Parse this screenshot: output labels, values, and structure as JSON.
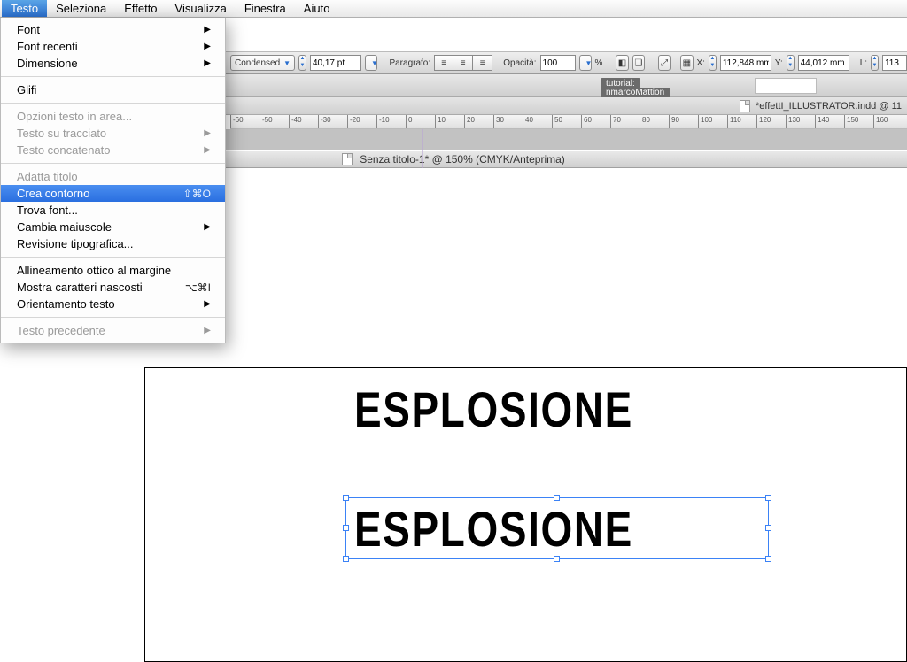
{
  "menubar": {
    "items": [
      "Testo",
      "Seleziona",
      "Effetto",
      "Visualizza",
      "Finestra",
      "Aiuto"
    ],
    "active_index": 0
  },
  "dropdown": {
    "groups": [
      [
        {
          "label": "Font",
          "submenu": true
        },
        {
          "label": "Font recenti",
          "submenu": true
        },
        {
          "label": "Dimensione",
          "submenu": true
        }
      ],
      [
        {
          "label": "Glifi"
        }
      ],
      [
        {
          "label": "Opzioni testo in area...",
          "disabled": true
        },
        {
          "label": "Testo su tracciato",
          "submenu": true,
          "disabled": true
        },
        {
          "label": "Testo concatenato",
          "submenu": true,
          "disabled": true
        }
      ],
      [
        {
          "label": "Adatta titolo",
          "disabled": true
        },
        {
          "label": "Crea contorno",
          "shortcut": "⇧⌘O",
          "highlight": true
        },
        {
          "label": "Trova font..."
        },
        {
          "label": "Cambia maiuscole",
          "submenu": true
        },
        {
          "label": "Revisione tipografica..."
        }
      ],
      [
        {
          "label": "Allineamento ottico al margine"
        },
        {
          "label": "Mostra caratteri nascosti",
          "shortcut": "⌥⌘I"
        },
        {
          "label": "Orientamento testo",
          "submenu": true
        }
      ],
      [
        {
          "label": "Testo precedente",
          "submenu": true,
          "disabled": true
        }
      ]
    ]
  },
  "controlbar": {
    "font_style": "Condensed",
    "font_size": "40,17 pt",
    "paragraph_label": "Paragrafo:",
    "opacity_label": "Opacità:",
    "opacity_value": "100",
    "opacity_unit": "%",
    "x_label": "X:",
    "x_value": "112,848 mm",
    "y_label": "Y:",
    "y_value": "44,012 mm",
    "l_label": "L:",
    "l_value": "113"
  },
  "tabs": {
    "other_doc": "*effettI_ILLUSTRATOR.indd @ 11",
    "chip1": "tutorial:",
    "chip2": "nmarcoMattion"
  },
  "window": {
    "title": "Senza titolo-1* @ 150% (CMYK/Anteprima)"
  },
  "ruler_ticks": [
    -60,
    -50,
    -40,
    -30,
    -20,
    -10,
    0,
    10,
    20,
    30,
    40,
    50,
    60,
    70,
    80,
    90,
    100,
    110,
    120,
    130,
    140,
    150,
    160
  ],
  "canvas": {
    "text": "ESPLOSIONE"
  }
}
